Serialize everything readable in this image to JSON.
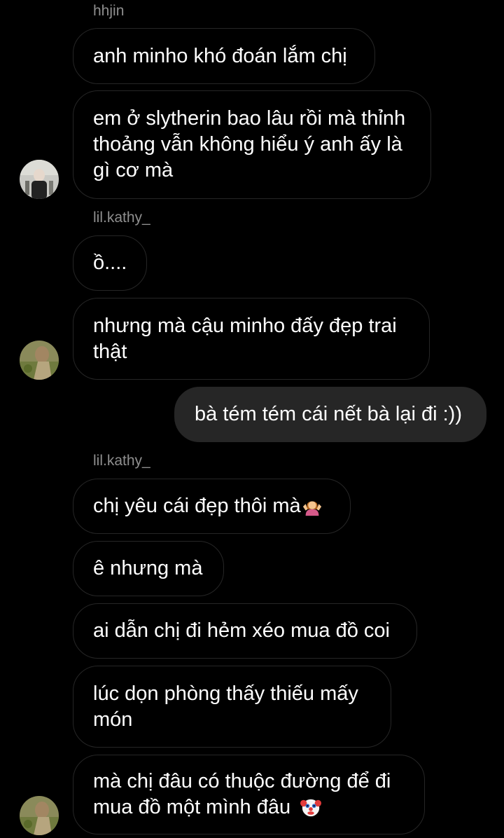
{
  "senders": {
    "hhjin": "hhjin",
    "kathy_1": "lil.kathy_",
    "kathy_2": "lil.kathy_"
  },
  "messages": {
    "m1": "anh minho khó đoán lắm chị",
    "m2": "em ở slytherin bao lâu rồi mà thỉnh\nthoảng vẫn không hiểu ý anh ấy là\ngì cơ mà",
    "m3": "ồ....",
    "m4": "nhưng mà cậu minho đấy đẹp trai\nthật",
    "m5": "bà tém tém cái nết bà lại đi :))",
    "m6": "chị yêu cái đẹp thôi mà",
    "m7": "ê nhưng mà",
    "m8": "ai dẫn chị đi hẻm xéo mua đồ coi",
    "m9": "lúc dọn phòng thấy thiếu mấy\nmón",
    "m10": "mà chị đâu có thuộc đường để đi\nmua đồ một mình đâu"
  },
  "emojis": {
    "m6": "woman-shrugging-emoji",
    "m10": "clown-face-emoji"
  },
  "colors": {
    "background": "#000000",
    "incoming_border": "#262626",
    "outgoing_fill": "#262626",
    "sender_name": "#8e8e8e",
    "text": "#ffffff"
  }
}
